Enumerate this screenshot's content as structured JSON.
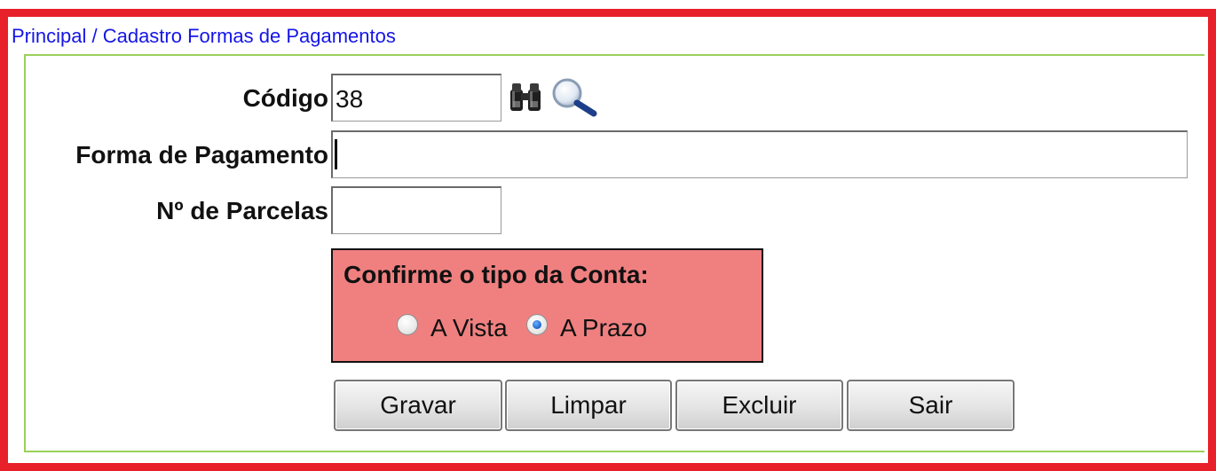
{
  "breadcrumb": "Principal / Cadastro Formas de Pagamentos",
  "form": {
    "codigo_label": "Código",
    "codigo_value": "38",
    "forma_label": "Forma de Pagamento",
    "forma_value": "",
    "parcelas_label": "Nº de Parcelas",
    "parcelas_value": ""
  },
  "account_type": {
    "title": "Confirme o tipo da Conta:",
    "options": [
      {
        "label": "A Vista",
        "selected": false
      },
      {
        "label": "A Prazo",
        "selected": true
      }
    ]
  },
  "buttons": {
    "gravar": "Gravar",
    "limpar": "Limpar",
    "excluir": "Excluir",
    "sair": "Sair"
  },
  "icons": {
    "binoculars": "binoculars-icon",
    "magnifier": "magnifier-icon"
  },
  "colors": {
    "frame_border": "#e8202a",
    "panel_border": "#9ad05a",
    "breadcrumb_text": "#1515e6",
    "account_box_bg": "#f08080"
  }
}
